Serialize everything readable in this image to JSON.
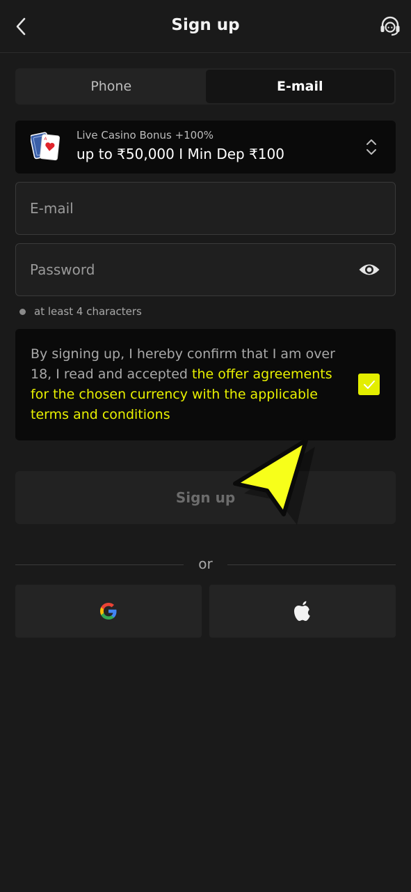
{
  "header": {
    "title": "Sign up",
    "back_icon": "chevron-left-icon",
    "support_icon": "headset-support-icon"
  },
  "tabs": [
    {
      "label": "Phone",
      "active": false
    },
    {
      "label": "E-mail",
      "active": true
    }
  ],
  "bonus": {
    "icon": "playing-cards-icon",
    "subtitle": "Live Casino Bonus +100%",
    "title": "up to ₹50,000 I Min Dep ₹100",
    "selector_icon": "up-down-chevrons-icon"
  },
  "form": {
    "email_placeholder": "E-mail",
    "email_value": "",
    "password_placeholder": "Password",
    "password_value": "",
    "eye_icon": "eye-icon",
    "password_hint": "at least 4 characters"
  },
  "terms": {
    "text_before": "By signing up, I hereby confirm that I am over 18, I read and accepted ",
    "link_text": "the offer agreements for the chosen currency with the applicable terms and conditions",
    "checked": true
  },
  "signup_button": "Sign up",
  "divider_text": "or",
  "social": [
    {
      "icon": "google-icon"
    },
    {
      "icon": "apple-icon"
    }
  ],
  "colors": {
    "background": "#1a1a1a",
    "accent": "#e3ee00",
    "panel": "#0a0a0a"
  }
}
